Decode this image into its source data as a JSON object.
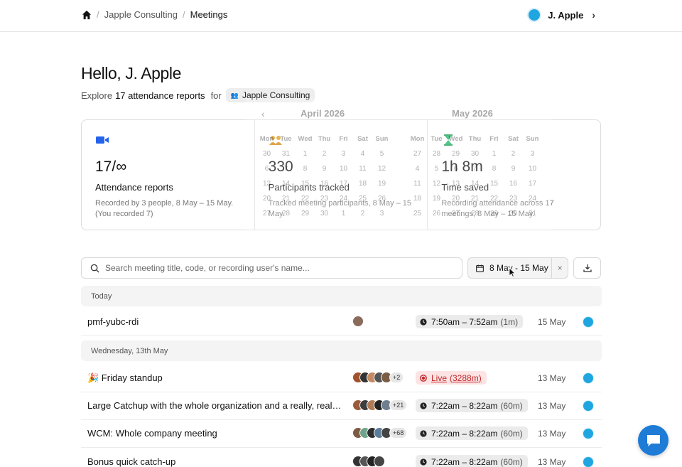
{
  "breadcrumb": {
    "items": [
      "Japple Consulting",
      "Meetings"
    ]
  },
  "user": {
    "name": "J. Apple"
  },
  "header": {
    "greeting": "Hello, J. Apple",
    "explore_prefix": "Explore",
    "report_count": "17 attendance reports",
    "for_word": "for",
    "org": "Japple Consulting"
  },
  "stats": [
    {
      "icon": "video-camera-icon",
      "value": "17/∞",
      "label": "Attendance reports",
      "desc": "Recorded by 3 people, 8 May – 15 May. (You recorded 7)"
    },
    {
      "icon": "participants-icon",
      "value": "330",
      "label": "Participants tracked",
      "desc": "Tracked meeting participants, 8 May – 15 May."
    },
    {
      "icon": "hourglass-icon",
      "value": "1h 8m",
      "label": "Time saved",
      "desc": "Recording attendance across 17 meetings, 8 May – 15 May."
    }
  ],
  "calendar": {
    "weekdays": [
      "Mon",
      "Tue",
      "Wed",
      "Thu",
      "Fri",
      "Sat",
      "Sun"
    ],
    "months": [
      {
        "name": "April 2026",
        "days": [
          "30",
          "31",
          "1",
          "2",
          "3",
          "4",
          "5",
          "6",
          "7",
          "8",
          "9",
          "10",
          "11",
          "12",
          "13",
          "14",
          "15",
          "16",
          "17",
          "18",
          "19",
          "20",
          "21",
          "22",
          "23",
          "24",
          "25",
          "26",
          "27",
          "28",
          "29",
          "30",
          "1",
          "2",
          "3"
        ]
      },
      {
        "name": "May 2026",
        "days": [
          "27",
          "28",
          "29",
          "30",
          "1",
          "2",
          "3",
          "4",
          "5",
          "6",
          "7",
          "8",
          "9",
          "10",
          "11",
          "12",
          "13",
          "14",
          "15",
          "16",
          "17",
          "18",
          "19",
          "20",
          "21",
          "22",
          "23",
          "24",
          "25",
          "26",
          "27",
          "28",
          "29",
          "30",
          "31"
        ]
      }
    ]
  },
  "toolbar": {
    "search_placeholder": "Search meeting title, code, or recording user's name...",
    "date_range": "8 May - 15 May",
    "clear_label": "×"
  },
  "groups": [
    {
      "label": "Today",
      "rows": [
        {
          "title": "pmf-yubc-rdi",
          "avatars": [
            "#8a6a5a"
          ],
          "more": "",
          "time": "7:50am – 7:52am",
          "duration": "(1m)",
          "live": false,
          "date": "15 May"
        }
      ]
    },
    {
      "label": "Wednesday, 13th May",
      "rows": [
        {
          "title": "🎉 Friday standup",
          "avatars": [
            "#a0522d",
            "#333333",
            "#c58a62",
            "#555555",
            "#7b5c45"
          ],
          "more": "+2",
          "time": "Live",
          "duration": "(3288m)",
          "live": true,
          "date": "13 May"
        },
        {
          "title": "Large Catchup with the whole organization and a really, really long meeting title",
          "avatars": [
            "#9b5b3b",
            "#3d3d3d",
            "#b07a55",
            "#222222",
            "#6f7f8f"
          ],
          "more": "+21",
          "time": "7:22am – 8:22am",
          "duration": "(60m)",
          "live": false,
          "date": "13 May"
        },
        {
          "title": "WCM: Whole company meeting",
          "avatars": [
            "#7d5a44",
            "#6fa38a",
            "#2e2e2e",
            "#5b7d9b",
            "#444444"
          ],
          "more": "+68",
          "time": "7:22am – 8:22am",
          "duration": "(60m)",
          "live": false,
          "date": "13 May"
        },
        {
          "title": "Bonus quick catch-up",
          "avatars": [
            "#333333",
            "#555555",
            "#222222",
            "#444444"
          ],
          "more": "",
          "time": "7:22am – 8:22am",
          "duration": "(60m)",
          "live": false,
          "date": "13 May"
        }
      ]
    }
  ],
  "colors": {
    "accent": "#1fa6e0",
    "live": "#c0282a",
    "chat": "#1e7bd6"
  }
}
